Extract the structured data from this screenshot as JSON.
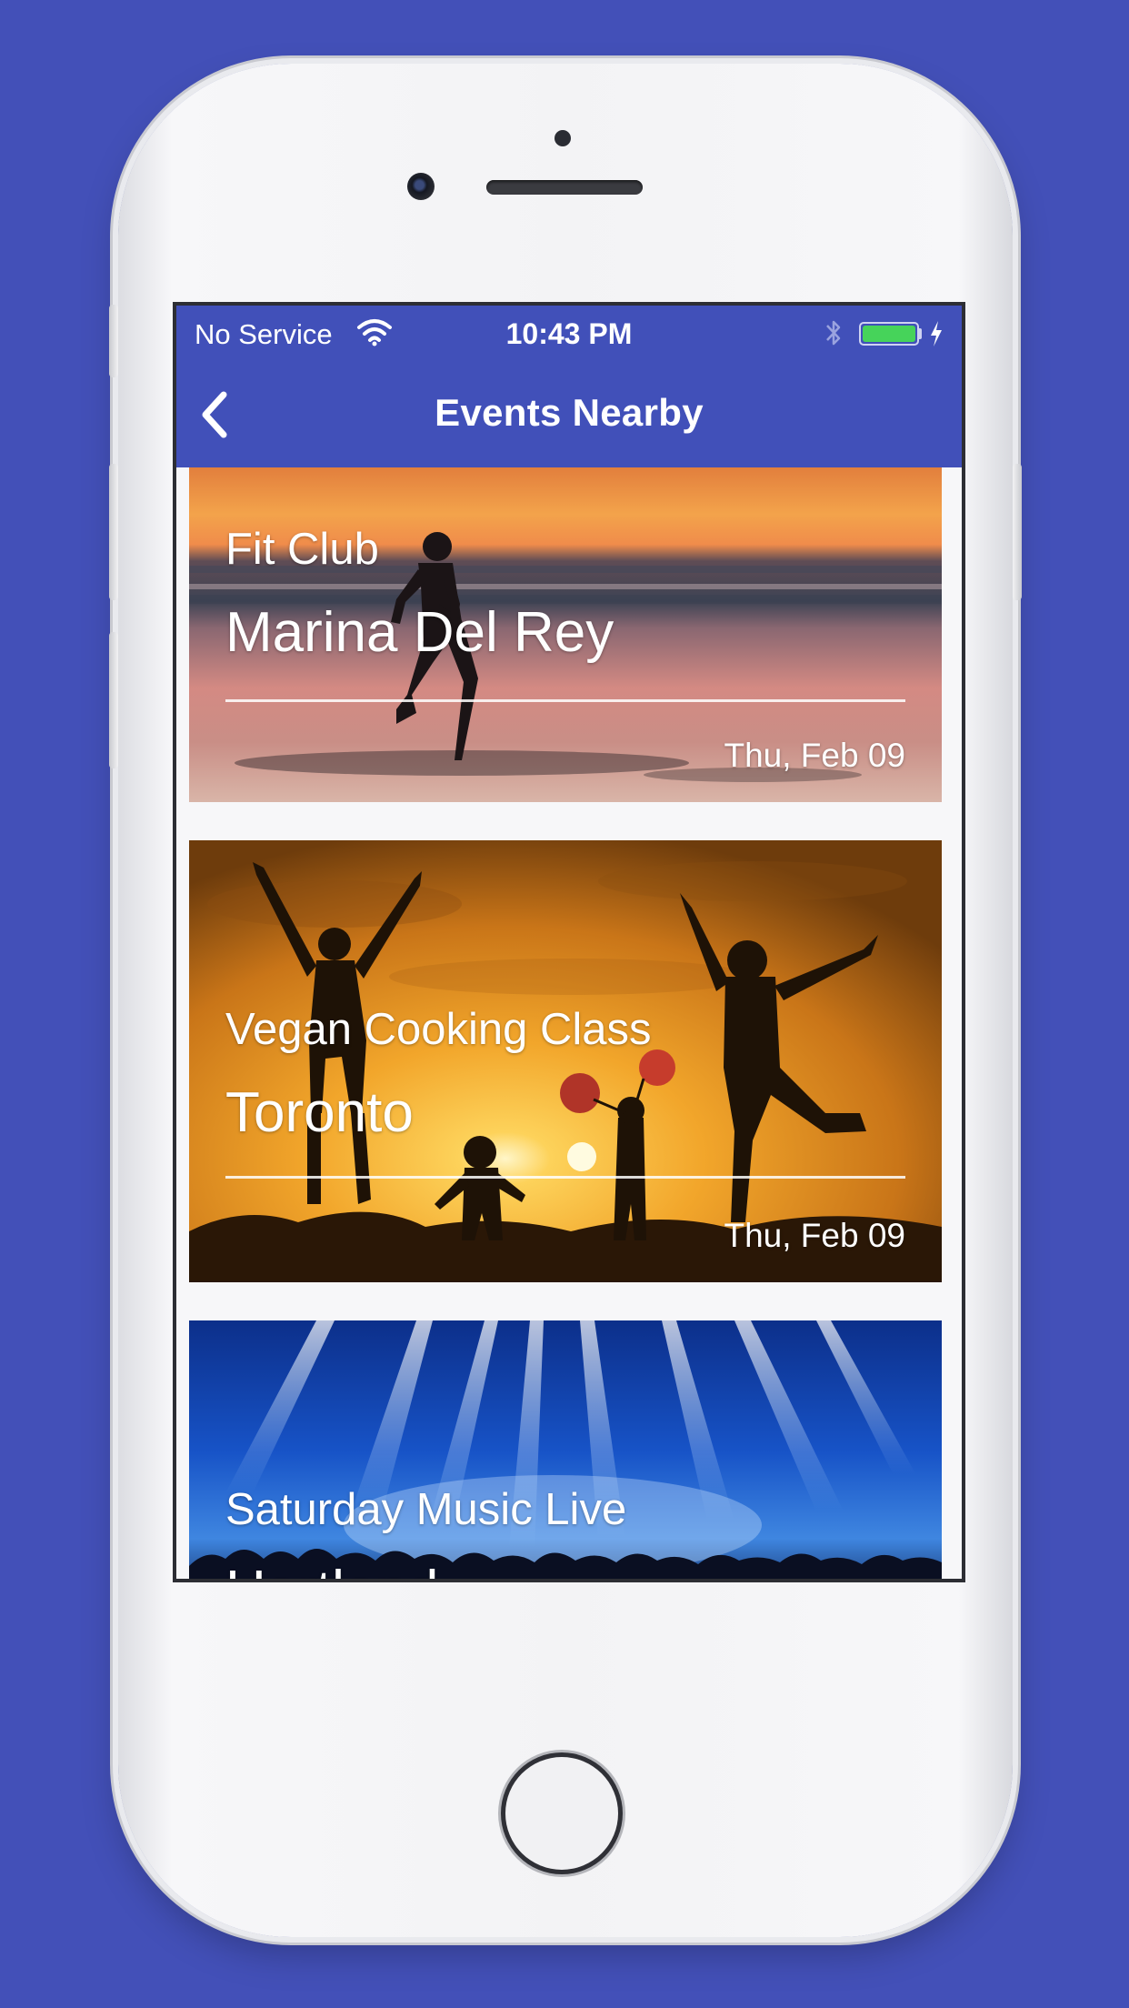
{
  "status_bar": {
    "carrier": "No Service",
    "time": "10:43 PM",
    "battery_level": 1.0,
    "icons": [
      "wifi-icon",
      "bluetooth-icon",
      "battery-icon",
      "charging-icon"
    ]
  },
  "nav": {
    "title": "Events Nearby",
    "back_icon": "chevron-left-icon"
  },
  "events": [
    {
      "category": "Fit Club",
      "location": "Marina Del Rey",
      "date": "Thu, Feb 09",
      "image": "beach-runner-sunset"
    },
    {
      "category": "Vegan Cooking Class",
      "location": "Toronto",
      "date": "Thu, Feb 09",
      "image": "family-jumping-sunset"
    },
    {
      "category": "Saturday Music Live",
      "location": "Hartland",
      "date": "",
      "image": "concert-stage-lights"
    }
  ],
  "colors": {
    "background": "#4350b8",
    "app_bar": "#4150b9",
    "battery": "#46d35a",
    "list_background": "#f7f7f9"
  }
}
